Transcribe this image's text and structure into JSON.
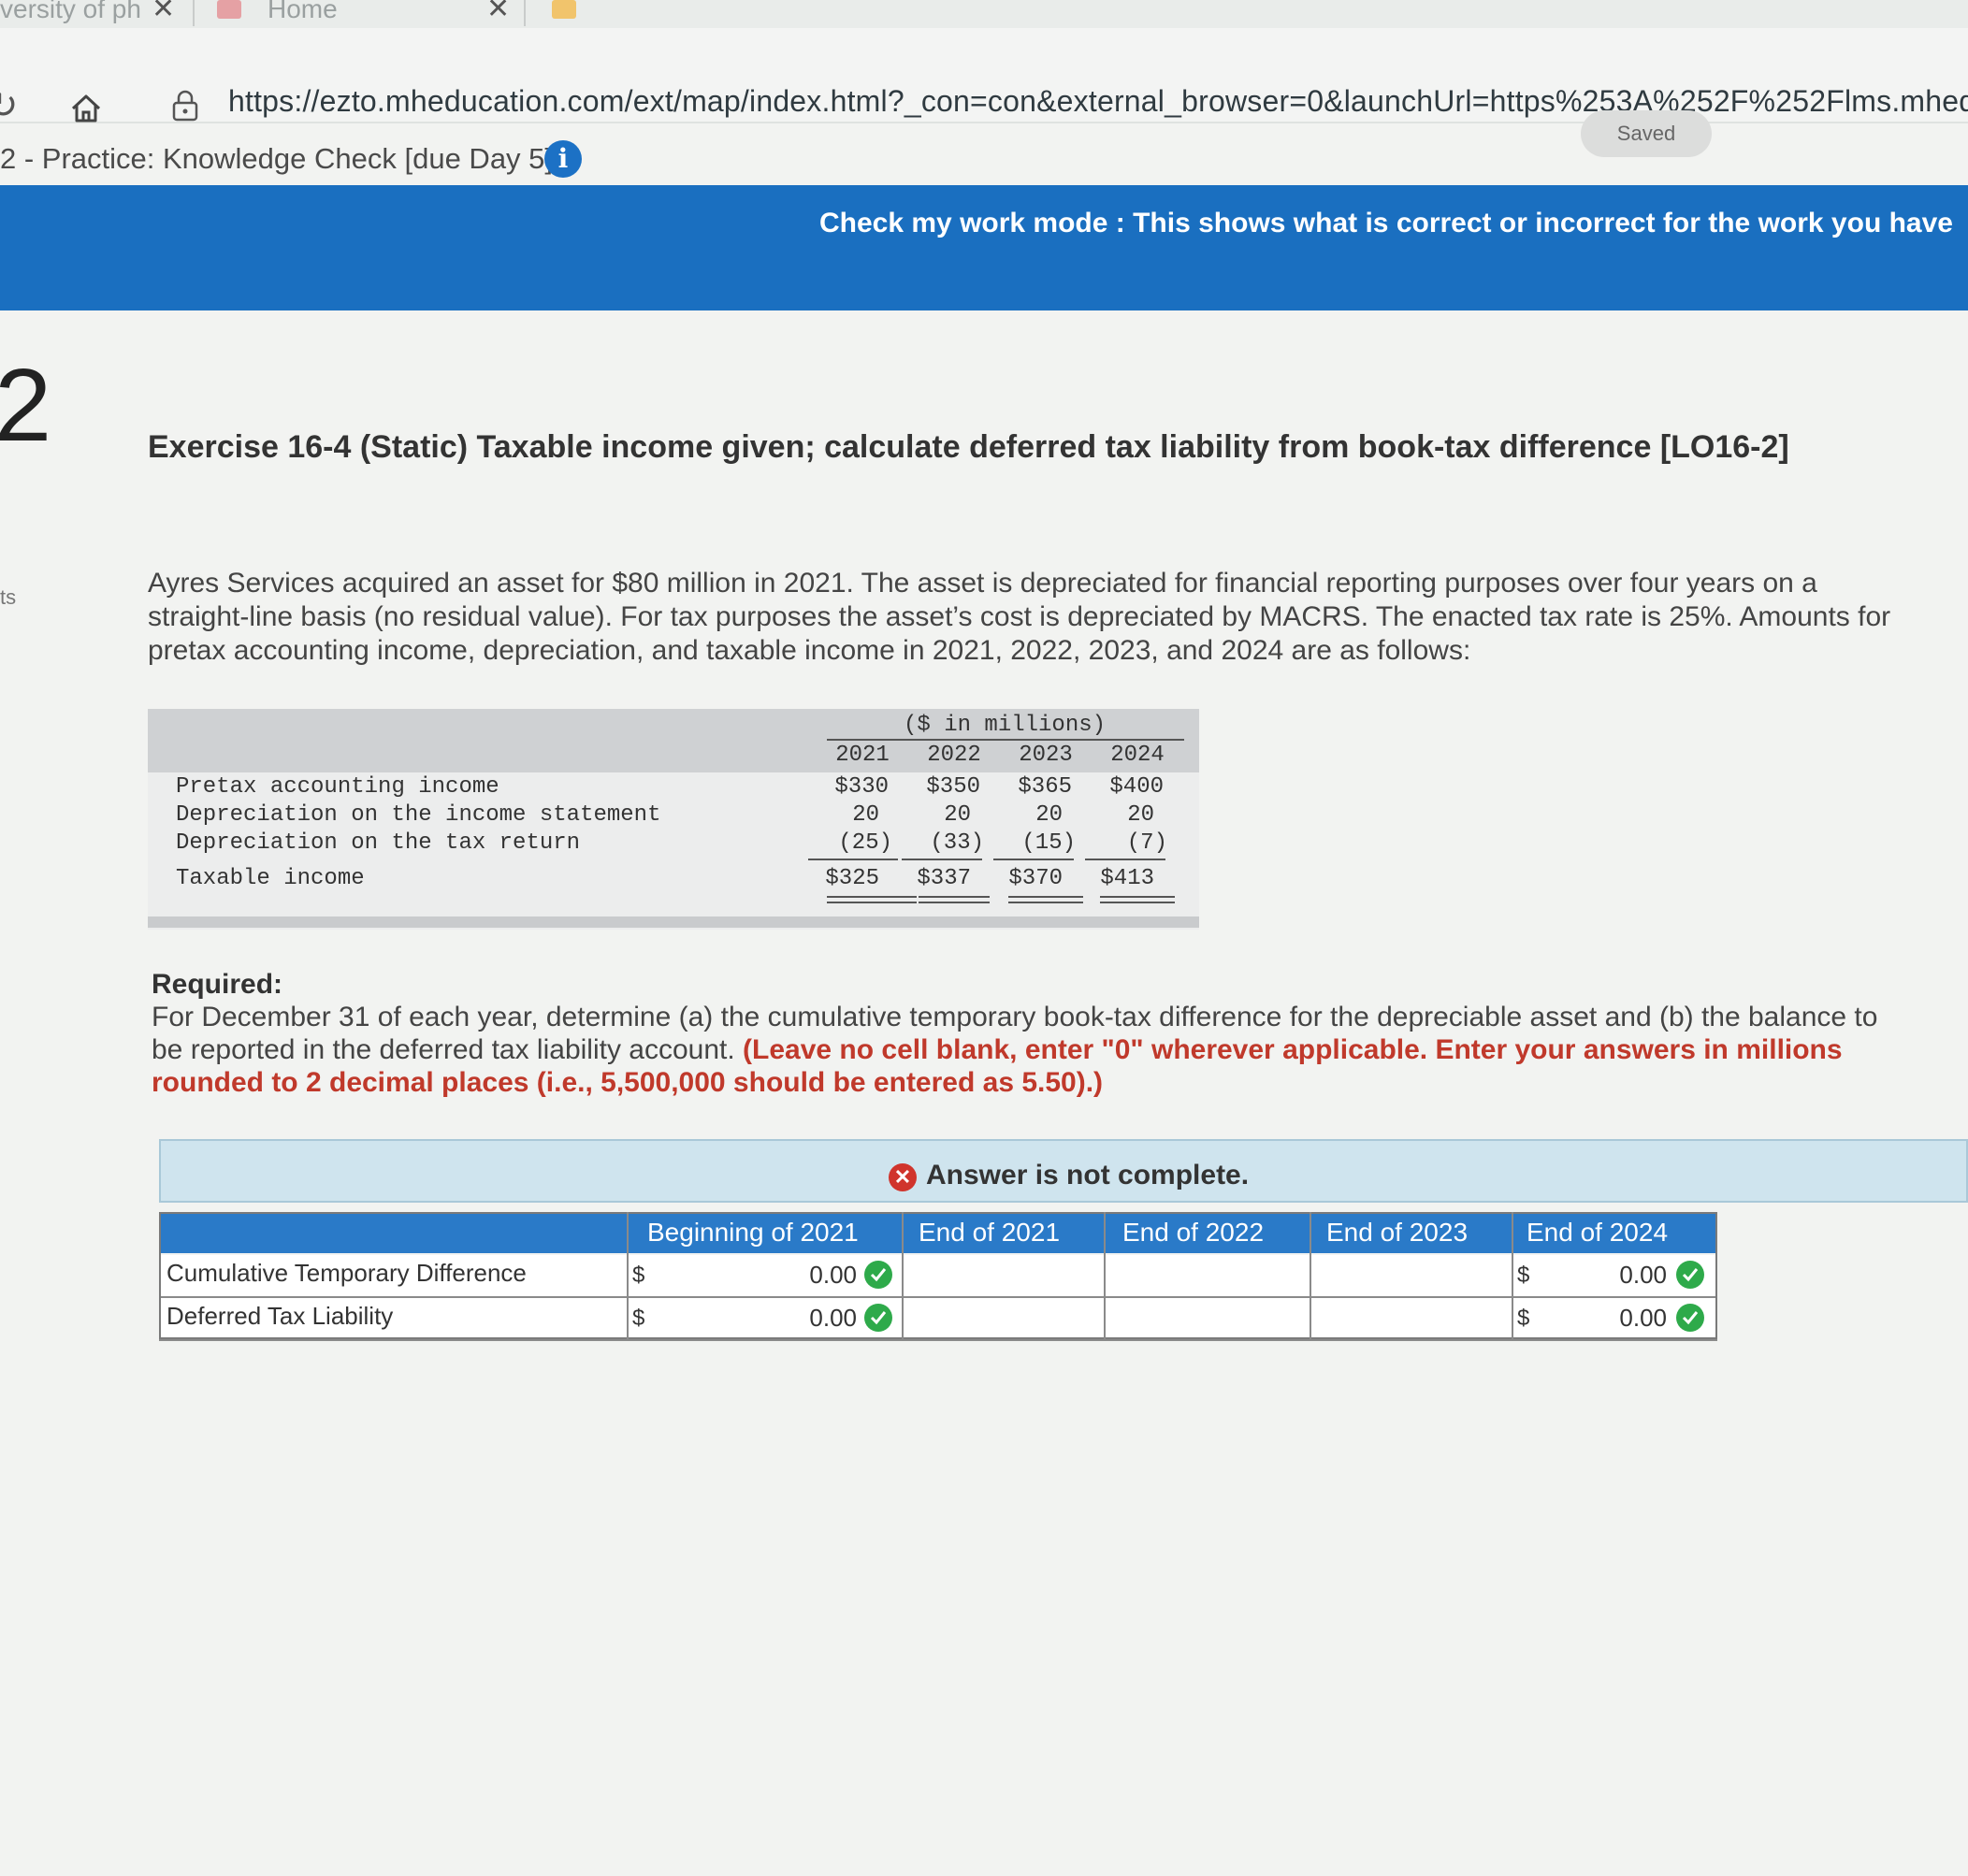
{
  "browser": {
    "tab_partial_title": "versity of ph",
    "tab_home": "Home",
    "url": "https://ezto.mheducation.com/ext/map/index.html?_con=con&external_browser=0&launchUrl=https%253A%252F%252Flms.mheducati"
  },
  "assignment": {
    "title": "2 - Practice: Knowledge Check [due Day 5]",
    "saved_label": "Saved"
  },
  "banner": {
    "text": "Check my work mode : This shows what is correct or incorrect for the work you have"
  },
  "question": {
    "number": "2",
    "side_label": "ts",
    "title": "Exercise 16-4 (Static) Taxable income given; calculate deferred tax liability from book-tax difference [LO16-2]",
    "description": "Ayres Services acquired an asset for $80 million in 2021. The asset is depreciated for financial reporting purposes over four years on a straight-line basis (no residual value). For tax purposes the asset’s cost is depreciated by MACRS. The enacted tax rate is 25%. Amounts for pretax accounting income, depreciation, and taxable income in 2021, 2022, 2023, and 2024 are as follows:"
  },
  "given_table": {
    "unit": "($ in millions)",
    "years": [
      "2021",
      "2022",
      "2023",
      "2024"
    ],
    "rows": [
      {
        "label": "Pretax accounting income",
        "values": [
          "$330",
          "$350",
          "$365",
          "$400"
        ]
      },
      {
        "label": "Depreciation on the income statement",
        "values": [
          "20",
          "20",
          "20",
          "20"
        ]
      },
      {
        "label": "Depreciation on the tax return",
        "values": [
          "(25)",
          "(33)",
          "(15)",
          "(7)"
        ]
      },
      {
        "label": "Taxable income",
        "values": [
          "$325",
          "$337",
          "$370",
          "$413"
        ]
      }
    ]
  },
  "required": {
    "heading": "Required:",
    "text": "For December 31 of each year, determine (a) the cumulative temporary book-tax difference for the depreciable asset and (b) the balance to be reported in the deferred tax liability account.",
    "instruction": "(Leave no cell blank, enter \"0\" wherever applicable. Enter your answers in millions rounded to 2 decimal places (i.e., 5,500,000 should be entered as 5.50).)"
  },
  "answer": {
    "status": "Answer is not complete.",
    "columns": [
      "Beginning of 2021",
      "End of 2021",
      "End of 2022",
      "End of 2023",
      "End of 2024"
    ],
    "rows": [
      {
        "label": "Cumulative Temporary Difference",
        "cells": [
          {
            "prefix": "$",
            "value": "0.00",
            "status": "correct"
          },
          {
            "prefix": "",
            "value": ""
          },
          {
            "prefix": "",
            "value": ""
          },
          {
            "prefix": "",
            "value": ""
          },
          {
            "prefix": "$",
            "value": "0.00",
            "status": "correct"
          }
        ]
      },
      {
        "label": "Deferred Tax Liability",
        "cells": [
          {
            "prefix": "$",
            "value": "0.00",
            "status": "correct"
          },
          {
            "prefix": "",
            "value": ""
          },
          {
            "prefix": "",
            "value": ""
          },
          {
            "prefix": "",
            "value": ""
          },
          {
            "prefix": "$",
            "value": "0.00",
            "status": "correct"
          }
        ]
      }
    ]
  },
  "colors": {
    "banner": "#1a6fc0",
    "grid_header": "#2a7ac8",
    "correct": "#2eaa4a",
    "incorrect": "#d0342c",
    "instruction": "#c0392b"
  }
}
